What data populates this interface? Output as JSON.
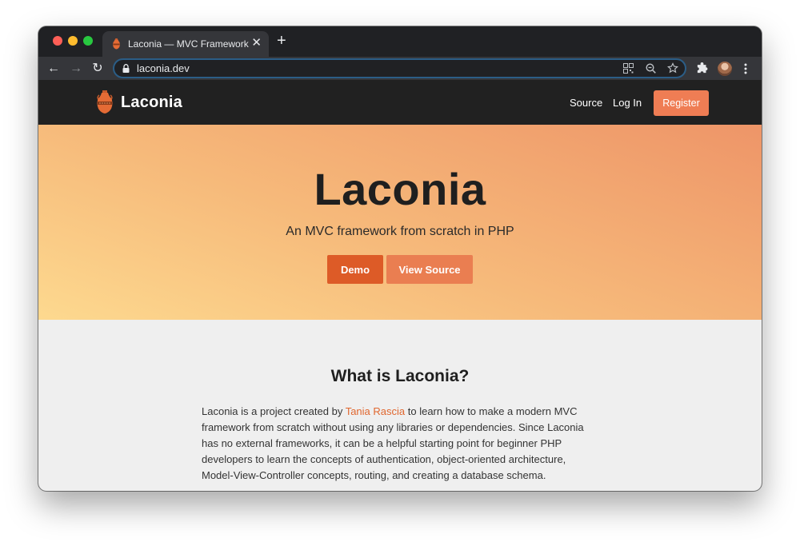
{
  "browser": {
    "tab_title": "Laconia — MVC Framework",
    "tab_close": "✕",
    "new_tab": "+",
    "url": "laconia.dev",
    "nav": {
      "back": "←",
      "forward": "→",
      "reload": "↻"
    }
  },
  "site": {
    "brand": "Laconia",
    "nav": {
      "source": "Source",
      "login": "Log In",
      "register": "Register"
    }
  },
  "hero": {
    "title": "Laconia",
    "subtitle": "An MVC framework from scratch in PHP",
    "demo_button": "Demo",
    "source_button": "View Source"
  },
  "about": {
    "title": "What is Laconia?",
    "text_before": "Laconia is a project created by ",
    "author": "Tania Rascia",
    "text_after": " to learn how to make a modern MVC framework from scratch without using any libraries or dependencies. Since Laconia has no external frameworks, it can be a helpful starting point for beginner PHP developers to learn the concepts of authentication, object-oriented architecture, Model-View-Controller concepts, routing, and creating a database schema."
  },
  "colors": {
    "accent": "#dd5b27",
    "accent_light": "#ef7d54",
    "link": "#e0672f",
    "nav_bg": "#212121"
  },
  "icons": [
    "back-icon",
    "forward-icon",
    "reload-icon",
    "lock-icon",
    "qr-code-icon",
    "zoom-icon",
    "star-icon",
    "extensions-icon",
    "menu-icon",
    "amphora-logo-icon"
  ]
}
